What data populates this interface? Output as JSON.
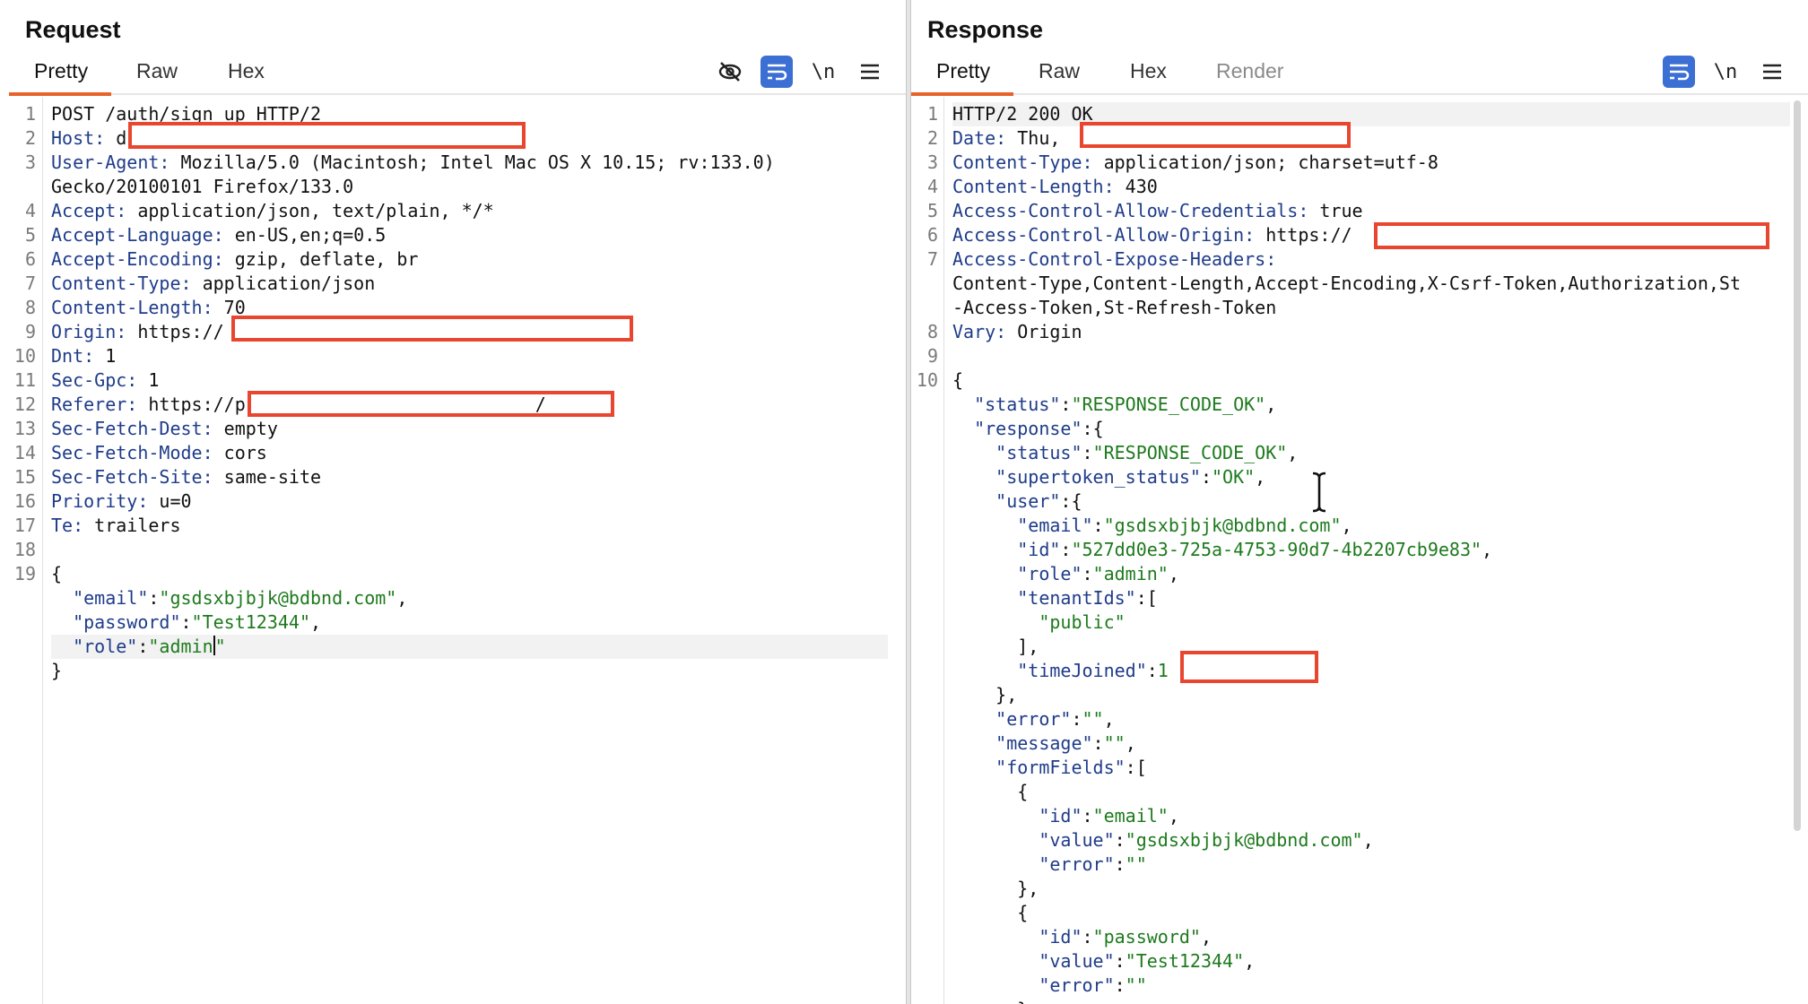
{
  "request": {
    "title": "Request",
    "tabs": [
      {
        "label": "Pretty",
        "active": true
      },
      {
        "label": "Raw",
        "active": false
      },
      {
        "label": "Hex",
        "active": false
      }
    ],
    "tools": [
      "hide-icon",
      "wrap-icon",
      "newline-icon",
      "menu-icon"
    ],
    "newline_label": "\\n",
    "lines": [
      {
        "n": "1",
        "key": "",
        "text": "POST /auth/sign_up HTTP/2"
      },
      {
        "n": "2",
        "key": "Host:",
        "text": " d"
      },
      {
        "n": "3",
        "key": "User-Agent:",
        "text": " Mozilla/5.0 (Macintosh; Intel Mac OS X 10.15; rv:133.0)"
      },
      {
        "n": "",
        "key": "",
        "text": "Gecko/20100101 Firefox/133.0"
      },
      {
        "n": "4",
        "key": "Accept:",
        "text": " application/json, text/plain, */*"
      },
      {
        "n": "5",
        "key": "Accept-Language:",
        "text": " en-US,en;q=0.5"
      },
      {
        "n": "6",
        "key": "Accept-Encoding:",
        "text": " gzip, deflate, br"
      },
      {
        "n": "7",
        "key": "Content-Type:",
        "text": " application/json"
      },
      {
        "n": "8",
        "key": "Content-Length:",
        "text": " 70"
      },
      {
        "n": "9",
        "key": "Origin:",
        "text": " https://"
      },
      {
        "n": "10",
        "key": "Dnt:",
        "text": " 1"
      },
      {
        "n": "11",
        "key": "Sec-Gpc:",
        "text": " 1"
      },
      {
        "n": "12",
        "key": "Referer:",
        "text": " https://p"
      },
      {
        "n": "13",
        "key": "Sec-Fetch-Dest:",
        "text": " empty"
      },
      {
        "n": "14",
        "key": "Sec-Fetch-Mode:",
        "text": " cors"
      },
      {
        "n": "15",
        "key": "Sec-Fetch-Site:",
        "text": " same-site"
      },
      {
        "n": "16",
        "key": "Priority:",
        "text": " u=0"
      },
      {
        "n": "17",
        "key": "Te:",
        "text": " trailers"
      },
      {
        "n": "18",
        "key": "",
        "text": ""
      },
      {
        "n": "19",
        "key": "",
        "text": "{"
      }
    ],
    "referer_tail": "/",
    "body": [
      {
        "key": "  \"email\"",
        "val": "\"gsdsxbjbjk@bdbnd.com\"",
        "end": ","
      },
      {
        "key": "  \"password\"",
        "val": "\"Test12344\"",
        "end": ","
      },
      {
        "key": "  \"role\"",
        "val": "\"admin",
        "end": "\""
      },
      {
        "key": "",
        "val": "",
        "end": "}"
      }
    ]
  },
  "response": {
    "title": "Response",
    "tabs": [
      {
        "label": "Pretty",
        "active": true
      },
      {
        "label": "Raw",
        "active": false
      },
      {
        "label": "Hex",
        "active": false
      },
      {
        "label": "Render",
        "active": false
      }
    ],
    "newline_label": "\\n",
    "headers": [
      {
        "n": "1",
        "key": "",
        "text": "HTTP/2 200 OK"
      },
      {
        "n": "2",
        "key": "Date:",
        "text": " Thu, "
      },
      {
        "n": "3",
        "key": "Content-Type:",
        "text": " application/json; charset=utf-8"
      },
      {
        "n": "4",
        "key": "Content-Length:",
        "text": " 430"
      },
      {
        "n": "5",
        "key": "Access-Control-Allow-Credentials:",
        "text": " true"
      },
      {
        "n": "6",
        "key": "Access-Control-Allow-Origin:",
        "text": " https://"
      },
      {
        "n": "7",
        "key": "Access-Control-Expose-Headers:",
        "text": ""
      },
      {
        "n": "",
        "key": "",
        "text": "Content-Type,Content-Length,Accept-Encoding,X-Csrf-Token,Authorization,St"
      },
      {
        "n": "",
        "key": "",
        "text": "-Access-Token,St-Refresh-Token"
      },
      {
        "n": "8",
        "key": "Vary:",
        "text": " Origin"
      },
      {
        "n": "9",
        "key": "",
        "text": ""
      },
      {
        "n": "10",
        "key": "",
        "text": "{"
      }
    ],
    "body": [
      {
        "key": "  \"status\"",
        "sep": ":",
        "val": "\"RESPONSE_CODE_OK\"",
        "end": ","
      },
      {
        "key": "  \"response\"",
        "sep": ":",
        "val": "",
        "end": "{"
      },
      {
        "key": "    \"status\"",
        "sep": ":",
        "val": "\"RESPONSE_CODE_OK\"",
        "end": ","
      },
      {
        "key": "    \"supertoken_status\"",
        "sep": ":",
        "val": "\"OK\"",
        "end": ","
      },
      {
        "key": "    \"user\"",
        "sep": ":",
        "val": "",
        "end": "{"
      },
      {
        "key": "      \"email\"",
        "sep": ":",
        "val": "\"gsdsxbjbjk@bdbnd.com\"",
        "end": ","
      },
      {
        "key": "      \"id\"",
        "sep": ":",
        "val": "\"527dd0e3-725a-4753-90d7-4b2207cb9e83\"",
        "end": ","
      },
      {
        "key": "      \"role\"",
        "sep": ":",
        "val": "\"admin\"",
        "end": ","
      },
      {
        "key": "      \"tenantIds\"",
        "sep": ":",
        "val": "",
        "end": "["
      },
      {
        "key": "",
        "sep": "",
        "val": "        \"public\"",
        "end": ""
      },
      {
        "key": "",
        "sep": "",
        "val": "",
        "end": "      ],"
      },
      {
        "key": "      \"timeJoined\"",
        "sep": ":",
        "val": "1",
        "end": ""
      },
      {
        "key": "",
        "sep": "",
        "val": "",
        "end": "    },"
      },
      {
        "key": "    \"error\"",
        "sep": ":",
        "val": "\"\"",
        "end": ","
      },
      {
        "key": "    \"message\"",
        "sep": ":",
        "val": "\"\"",
        "end": ","
      },
      {
        "key": "    \"formFields\"",
        "sep": ":",
        "val": "",
        "end": "["
      },
      {
        "key": "",
        "sep": "",
        "val": "",
        "end": "      {"
      },
      {
        "key": "        \"id\"",
        "sep": ":",
        "val": "\"email\"",
        "end": ","
      },
      {
        "key": "        \"value\"",
        "sep": ":",
        "val": "\"gsdsxbjbjk@bdbnd.com\"",
        "end": ","
      },
      {
        "key": "        \"error\"",
        "sep": ":",
        "val": "\"\"",
        "end": ""
      },
      {
        "key": "",
        "sep": "",
        "val": "",
        "end": "      },"
      },
      {
        "key": "",
        "sep": "",
        "val": "",
        "end": "      {"
      },
      {
        "key": "        \"id\"",
        "sep": ":",
        "val": "\"password\"",
        "end": ","
      },
      {
        "key": "        \"value\"",
        "sep": ":",
        "val": "\"Test12344\"",
        "end": ","
      },
      {
        "key": "        \"error\"",
        "sep": ":",
        "val": "\"\"",
        "end": ""
      },
      {
        "key": "",
        "sep": "",
        "val": "",
        "end": "      }"
      }
    ]
  },
  "colors": {
    "accent": "#e8632b",
    "redaction": "#e8462f",
    "header_key": "#1f3c8a",
    "string": "#1d7a1d",
    "tool_active": "#3b6fd4"
  }
}
